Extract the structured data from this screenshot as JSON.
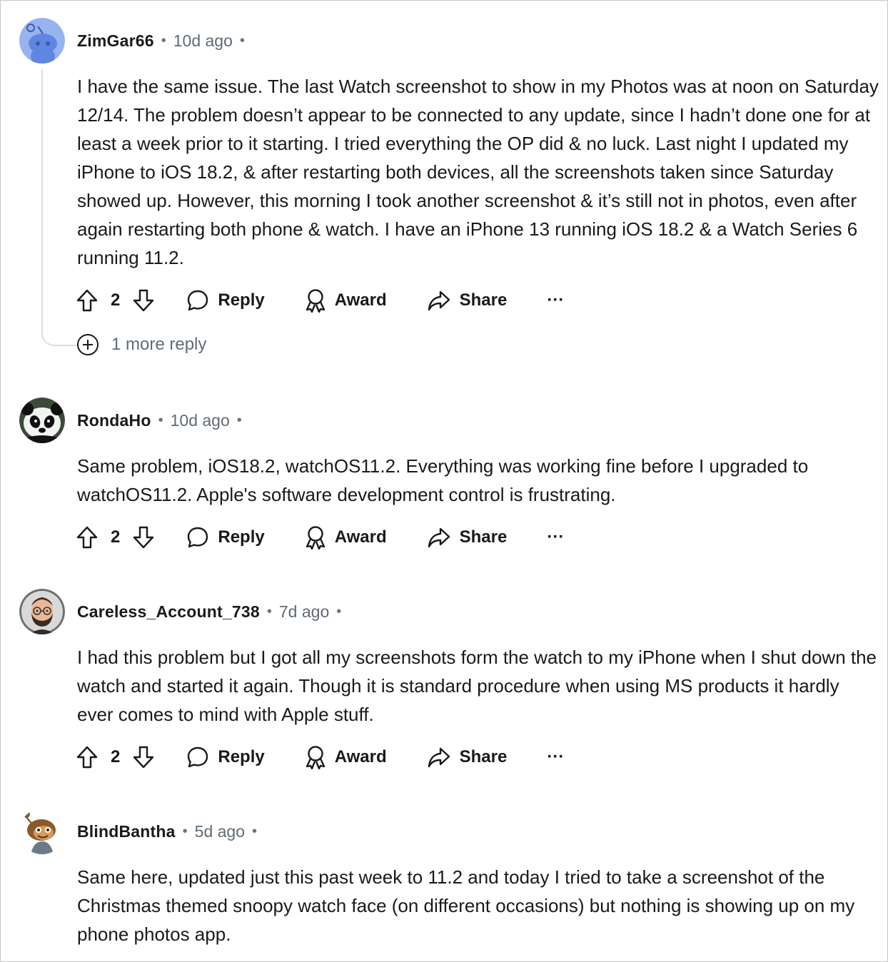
{
  "comments": [
    {
      "author": "ZimGar66",
      "time": "10d ago",
      "avatar": "reddit-snoo-default-avatar",
      "body": "I have the same issue. The last Watch screenshot to show in my Photos was at noon on Saturday 12/14. The problem doesn’t appear to be connected to any update, since I hadn’t done one for at least a week prior to it starting. I tried everything the OP did & no luck. Last night I updated my iPhone to iOS 18.2, & after restarting both devices, all the screenshots taken since Saturday showed up. However, this morning I took another screenshot & it’s still not in photos, even after again restarting both phone & watch. I have an iPhone 13 running iOS 18.2 & a Watch Series 6 running 11.2.",
      "votes": "2",
      "more_replies": "1 more reply"
    },
    {
      "author": "RondaHo",
      "time": "10d ago",
      "avatar": "panda-avatar",
      "body": "Same problem, iOS18.2, watchOS11.2. Everything was working fine before I upgraded to watchOS11.2. Apple's software development control is frustrating.",
      "votes": "2"
    },
    {
      "author": "Careless_Account_738",
      "time": "7d ago",
      "avatar": "bearded-man-avatar",
      "body": "I had this problem but I got all my screenshots form the watch to my iPhone when I shut down the watch and started it again. Though it is standard procedure when using MS products it hardly ever comes to mind with Apple stuff.",
      "votes": "2"
    },
    {
      "author": "BlindBantha",
      "time": "5d ago",
      "avatar": "snoo-custom-avatar",
      "body": "Same here, updated just this past week to 11.2 and today I tried to take a screenshot of the Christmas themed snoopy watch face (on different occasions) but nothing is showing up on my phone photos app."
    }
  ],
  "actions": {
    "reply": "Reply",
    "award": "Award",
    "share": "Share",
    "more": "···"
  },
  "icons": {
    "upvote": "upvote-arrow-icon",
    "downvote": "downvote-arrow-icon",
    "reply": "speech-bubble-icon",
    "award": "award-ribbon-icon",
    "share": "share-arrow-icon",
    "expand": "plus-circle-icon"
  },
  "colors": {
    "text": "#1a1a1b",
    "meta": "#5f6b76",
    "thread_line": "#dcdfe2"
  }
}
